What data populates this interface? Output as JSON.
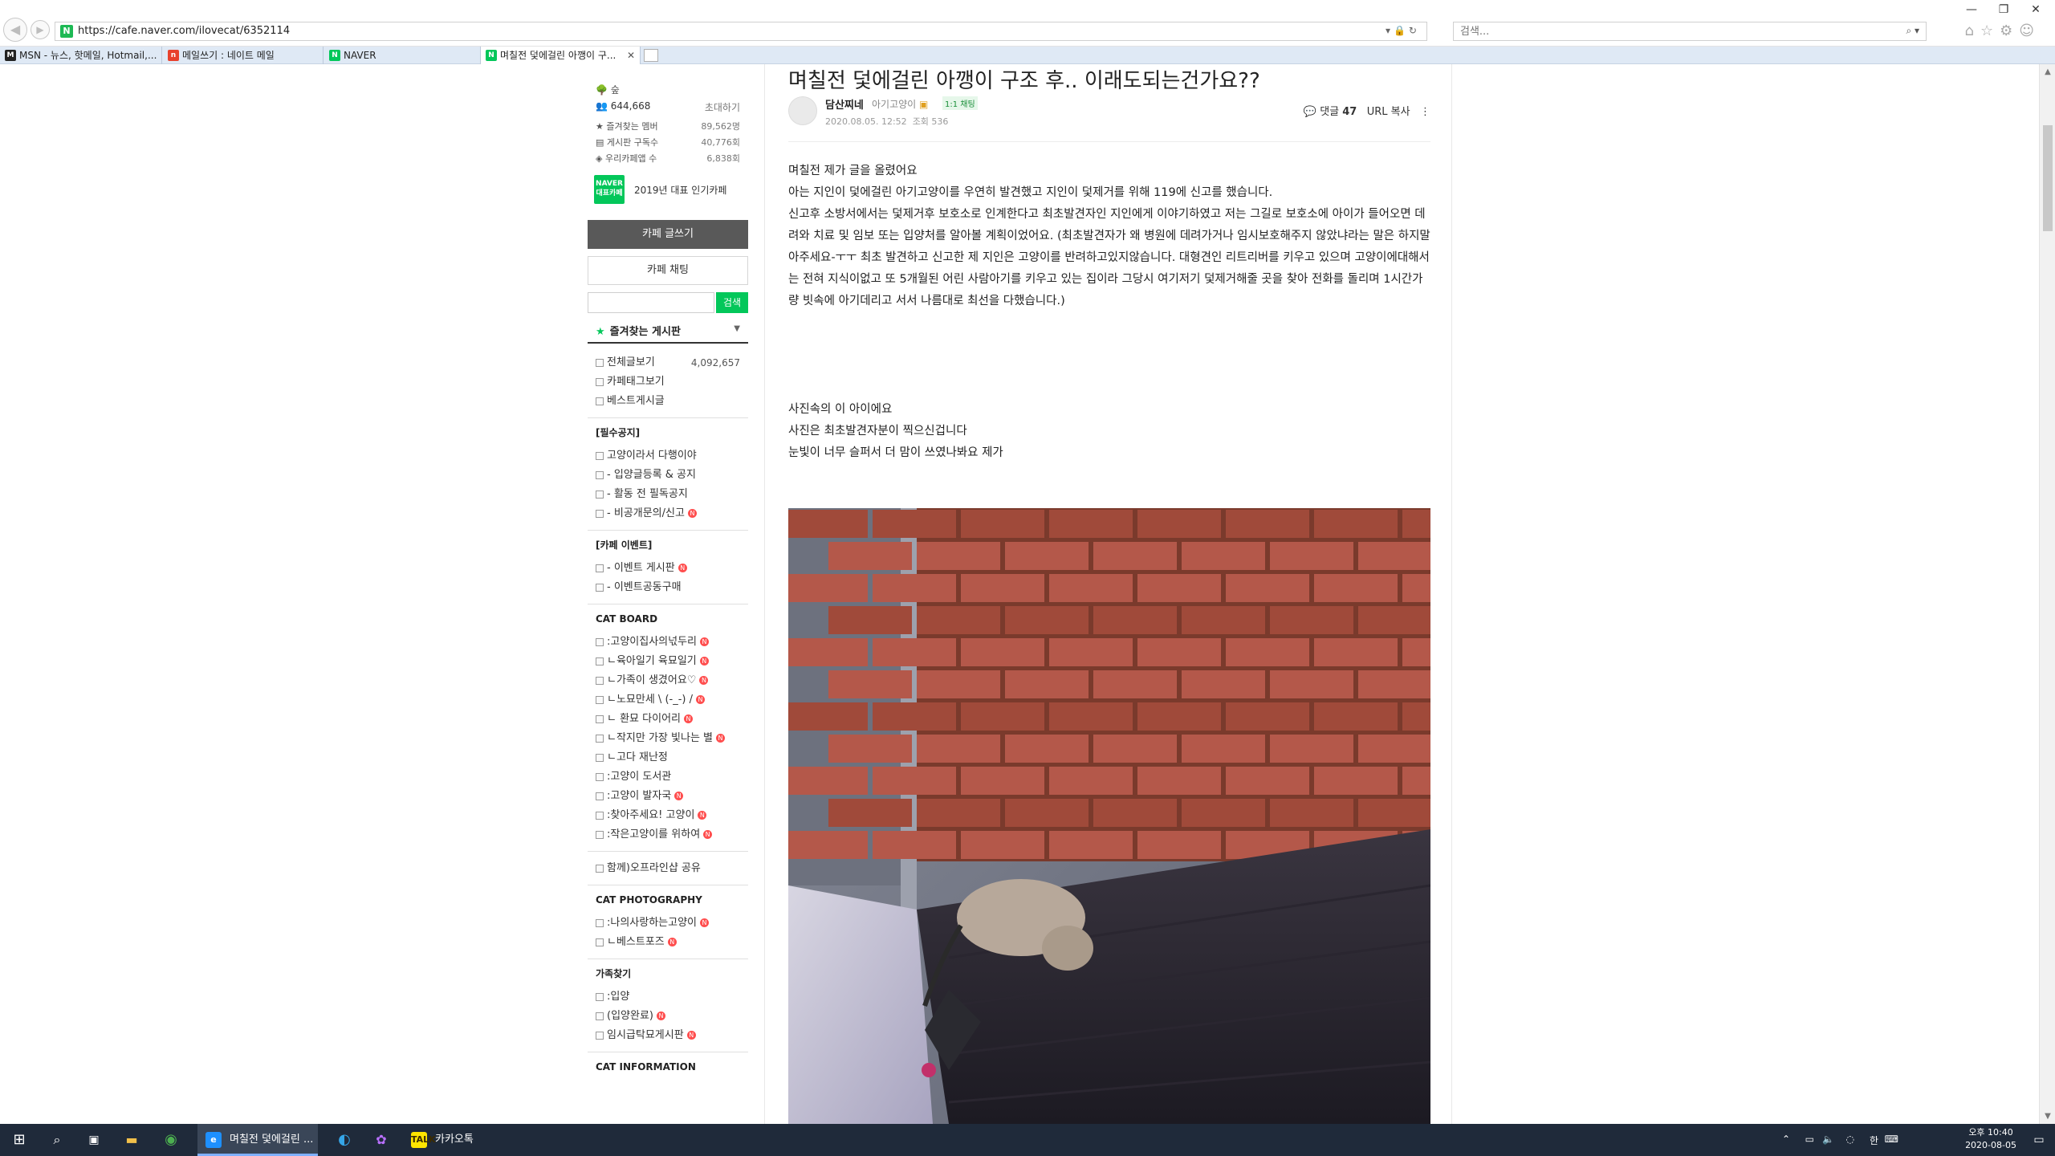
{
  "browser": {
    "url": "https://cafe.naver.com/ilovecat/6352114",
    "search_placeholder": "검색...",
    "tabs": [
      {
        "label": "MSN - 뉴스, 핫메일, Hotmail,...",
        "icon": "msn-icon",
        "color": "#222222"
      },
      {
        "label": "메일쓰기 : 네이트 메일",
        "icon": "nate-mail-icon",
        "color": "#e8412c"
      },
      {
        "label": "NAVER",
        "icon": "naver-icon",
        "color": "#03c75a"
      },
      {
        "label": "며칠전 덫에걸린 아깽이 구...",
        "icon": "naver-cafe-icon",
        "color": "#03c75a"
      }
    ]
  },
  "sidebar": {
    "cafe_level": "숲",
    "member_count": "644,668",
    "invite_label": "초대하기",
    "stats": [
      {
        "label": "즐겨찾는 멤버",
        "value": "89,562명"
      },
      {
        "label": "게시판 구독수",
        "value": "40,776회"
      },
      {
        "label": "우리카페앱 수",
        "value": "6,838회"
      }
    ],
    "badge_logo": "NAVER 대표카페",
    "badge_text": "2019년 대표 인기카페",
    "write_button": "카페 글쓰기",
    "chat_button": "카페 채팅",
    "search_button": "검색",
    "favorites_title": "즐겨찾는 게시판",
    "board_links": [
      {
        "label": "전체글보기",
        "count": "4,092,657"
      },
      {
        "label": "카페태그보기"
      },
      {
        "label": "베스트게시글"
      }
    ],
    "groups": [
      {
        "title": "[필수공지]",
        "items": [
          {
            "label": "고양이라서 다행이야",
            "new": false
          },
          {
            "label": "- 입양글등록 & 공지",
            "new": false
          },
          {
            "label": "- 활동 전 필독공지",
            "new": false
          },
          {
            "label": "- 비공개문의/신고",
            "new": true
          }
        ]
      },
      {
        "title": "[카페 이벤트]",
        "items": [
          {
            "label": "- 이벤트 게시판",
            "new": true
          },
          {
            "label": "- 이벤트공동구매",
            "new": false
          }
        ]
      },
      {
        "title": "CAT BOARD",
        "items": [
          {
            "label": ":고양이집사의넋두리",
            "new": true
          },
          {
            "label": "ㄴ육아일기 육묘일기",
            "new": true
          },
          {
            "label": "ㄴ가족이 생겼어요♡",
            "new": true
          },
          {
            "label": "ㄴ노묘만세 \\ (-_-) /",
            "new": true
          },
          {
            "label": "ㄴ 환묘 다이어리",
            "new": true
          },
          {
            "label": "ㄴ작지만 가장 빛나는 별",
            "new": true
          },
          {
            "label": "ㄴ고다 재난정",
            "new": false
          },
          {
            "label": ":고양이 도서관",
            "new": false
          },
          {
            "label": ":고양이 발자국",
            "new": true
          },
          {
            "label": ":찾아주세요! 고양이",
            "new": true
          },
          {
            "label": ":작은고양이를 위하여",
            "new": true
          }
        ]
      },
      {
        "title": "",
        "items": [
          {
            "label": "함께)오프라인샵 공유",
            "new": false
          }
        ]
      },
      {
        "title": "CAT PHOTOGRAPHY",
        "items": [
          {
            "label": ":나의사랑하는고양이",
            "new": true
          },
          {
            "label": "ㄴ베스트포즈",
            "new": true
          }
        ]
      },
      {
        "title": "가족찾기",
        "items": [
          {
            "label": ":입양",
            "new": false
          },
          {
            "label": "(입양완료)",
            "new": true
          },
          {
            "label": "임시급탁묘게시판",
            "new": true
          }
        ]
      },
      {
        "title": "CAT INFORMATION",
        "items": []
      }
    ]
  },
  "article": {
    "title": "며칠전 덫에걸린 아깽이 구조 후.. 이래도되는건가요??",
    "author": "담산찌네",
    "level": "아기고양이",
    "chat_label": "1:1 채팅",
    "date": "2020.08.05. 12:52",
    "views": "조회 536",
    "comment_label": "댓글",
    "comment_count": "47",
    "url_copy": "URL 복사",
    "paragraphs": [
      "며칠전 제가 글을 올렸어요",
      "아는 지인이 덫에걸린 아기고양이를 우연히 발견했고 지인이 덫제거를 위해 119에 신고를 했습니다.",
      "신고후 소방서에서는 덫제거후 보호소로 인계한다고 최초발견자인 지인에게 이야기하였고 저는 그길로 보호소에 아이가 들어오면 데려와 치료 및 임보 또는 입양처를 알아볼 계획이었어요. (최초발견자가 왜 병원에 데려가거나 임시보호해주지 않았냐라는 말은 하지말아주세요-ㅜㅜ 최초 발견하고 신고한 제 지인은 고양이를 반려하고있지않습니다. 대형견인 리트리버를 키우고 있으며 고양이에대해서는 전혀 지식이없고 또 5개월된 어린 사람아기를 키우고 있는 집이라 그당시 여기저기 덫제거해줄 곳을 찾아 전화를 돌리며 1시간가량 빗속에 아기데리고 서서 나름대로 최선을 다했습니다.)"
    ],
    "paragraphs2": [
      "사진속의 이 아이에요",
      "사진은 최초발견자분이 찍으신겁니다",
      "눈빛이 너무 슬퍼서 더 맘이 쓰였나봐요 제가"
    ]
  },
  "taskbar": {
    "apps": [
      {
        "label": "며칠전 덫에걸린 ...",
        "icon": "ie-icon",
        "color": "#1e90ff"
      },
      {
        "label": "카카오톡",
        "icon": "kakaotalk-icon",
        "color": "#fee500"
      }
    ],
    "time": "오후 10:40",
    "date": "2020-08-05"
  }
}
